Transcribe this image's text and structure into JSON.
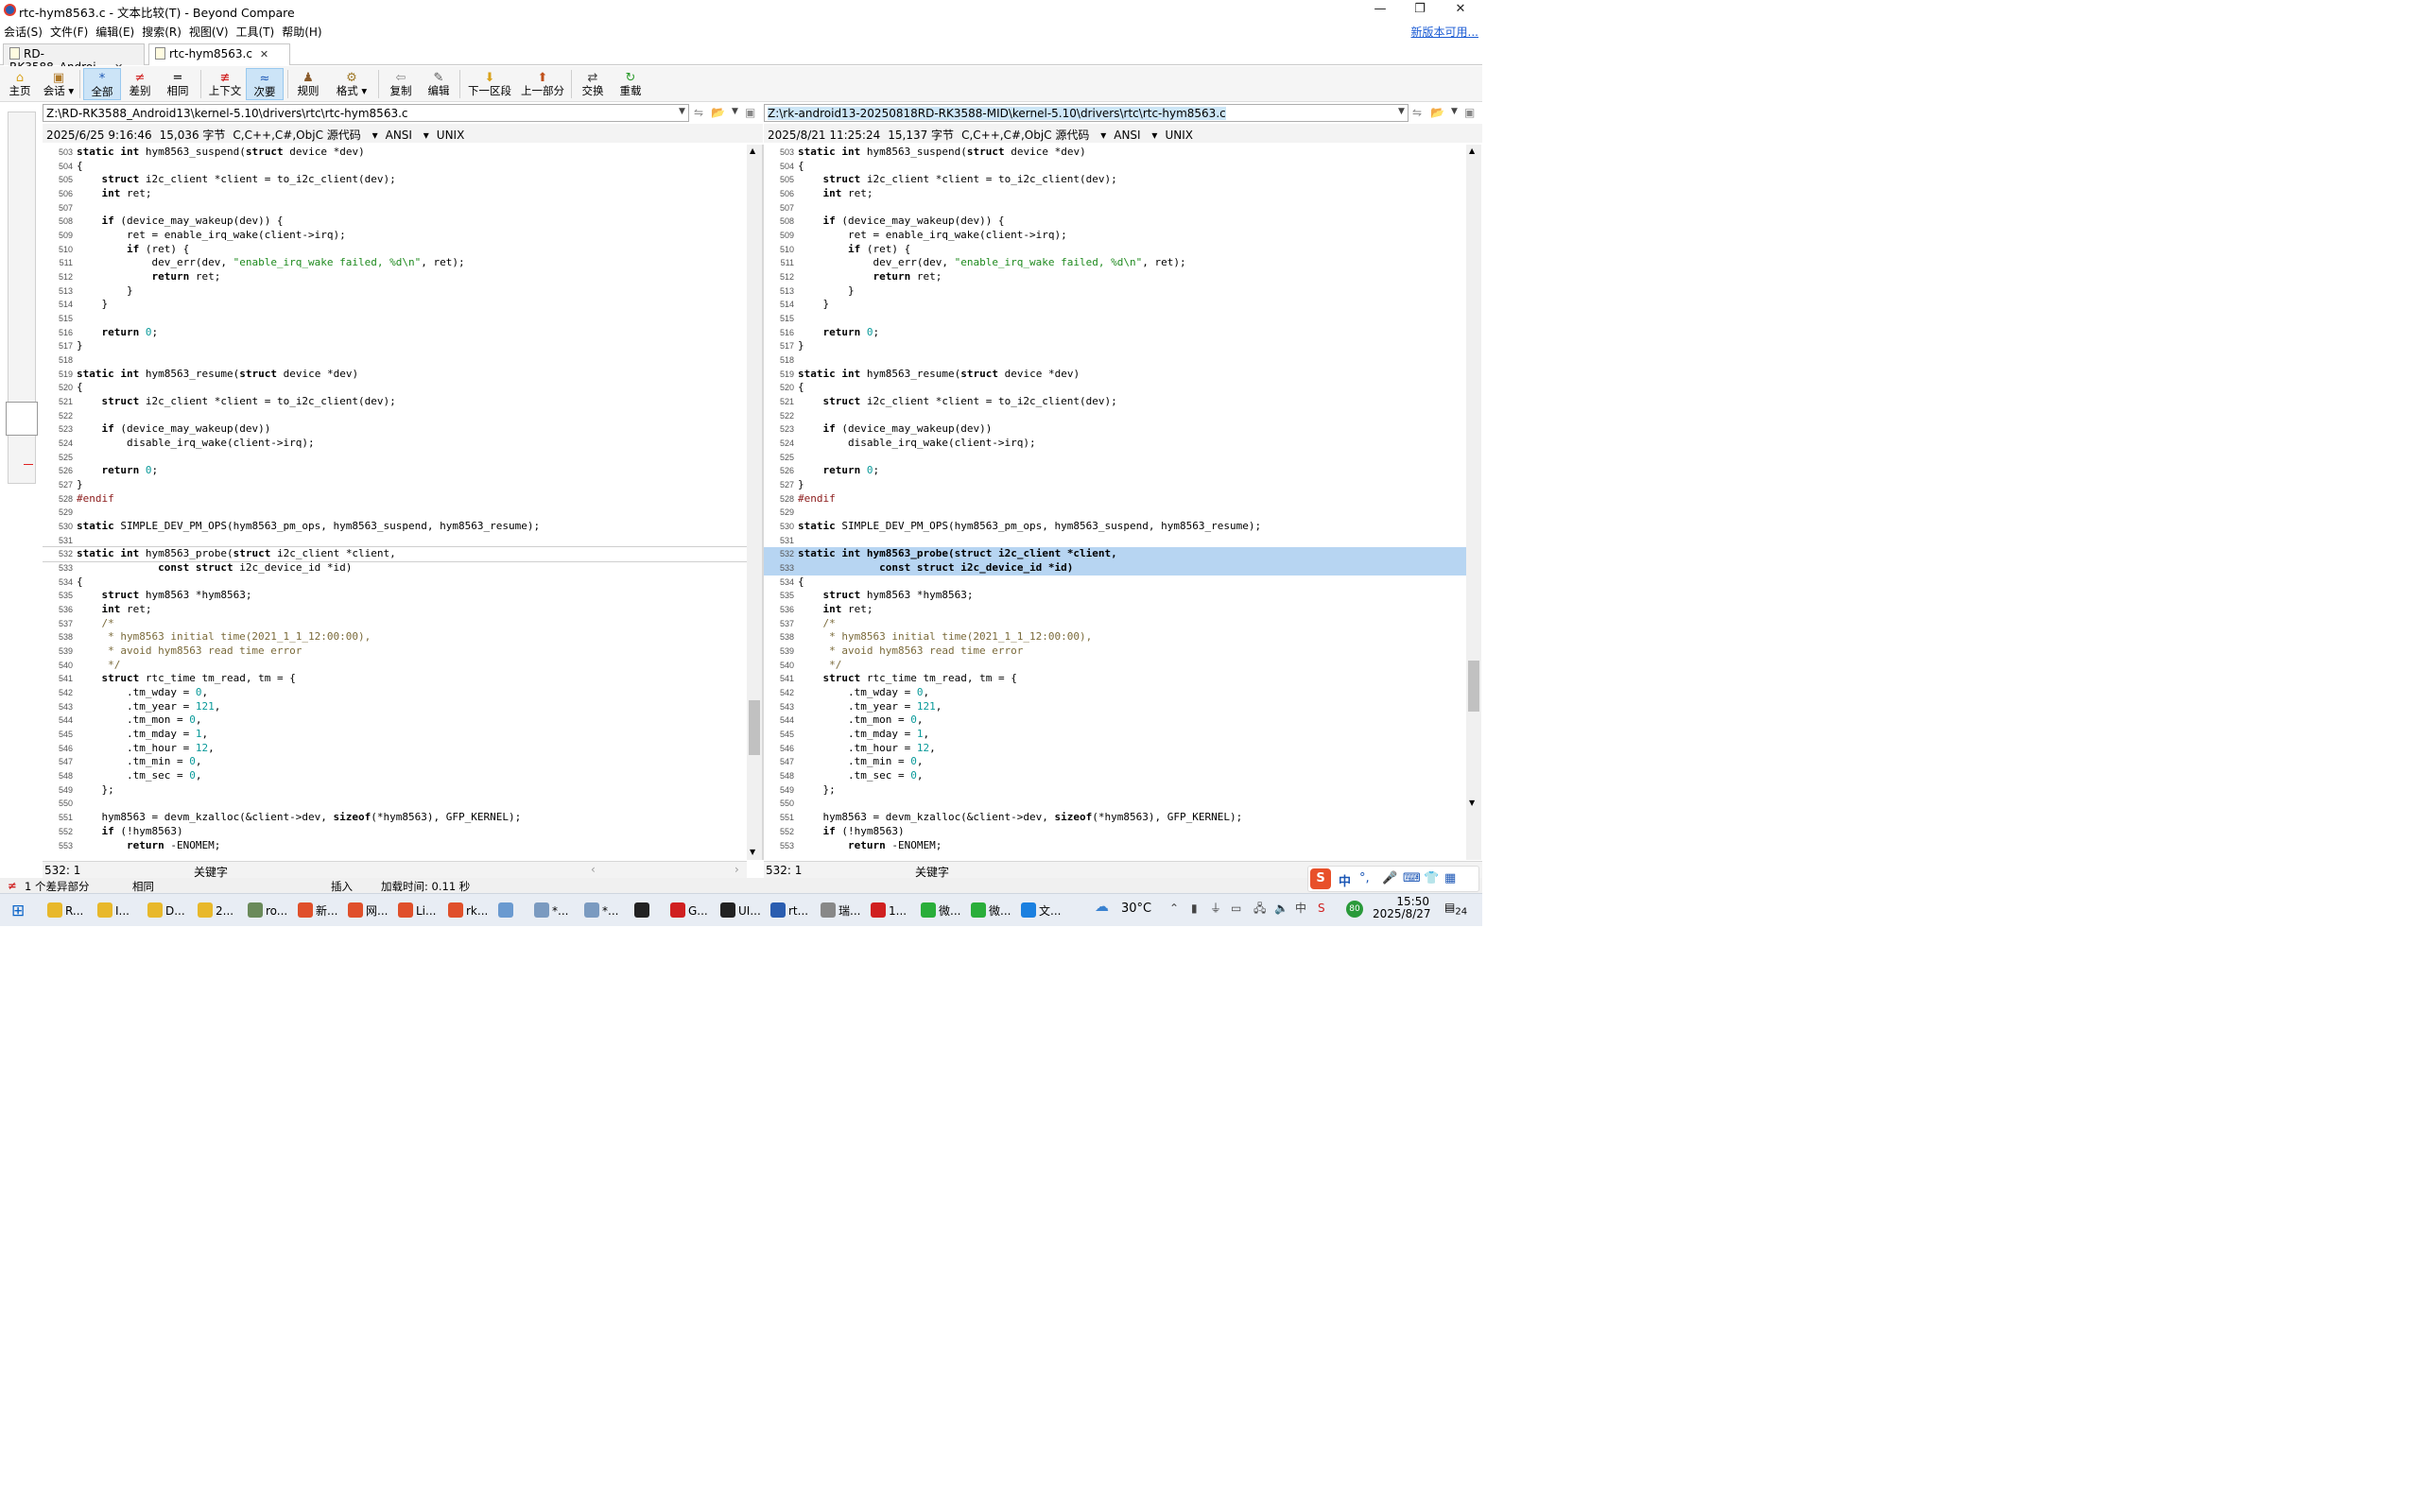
{
  "window": {
    "title": "rtc-hym8563.c - 文本比较(T) - Beyond Compare",
    "min": "—",
    "max": "❐",
    "close": "✕"
  },
  "menu": {
    "items": [
      "会话(S)",
      "文件(F)",
      "编辑(E)",
      "搜索(R)",
      "视图(V)",
      "工具(T)",
      "帮助(H)"
    ],
    "update": "新版本可用..."
  },
  "tabs": [
    {
      "label": "RD-RK3588_Androi...",
      "close": "✕"
    },
    {
      "label": "rtc-hym8563.c",
      "close": "✕"
    }
  ],
  "toolbar": {
    "items": [
      "主页",
      "会话",
      "全部",
      "差别",
      "相同",
      "上下文",
      "次要",
      "规则",
      "格式",
      "复制",
      "编辑",
      "下一区段",
      "上一部分",
      "交换",
      "重载"
    ]
  },
  "left": {
    "path": "Z:\\RD-RK3588_Android13\\kernel-5.10\\drivers\\rtc\\rtc-hym8563.c",
    "date": "2025/6/25 9:16:46",
    "size": "15,036 字节",
    "format": "C,C++,C#,ObjC 源代码",
    "encoding": "ANSI",
    "eol": "UNIX",
    "position": "532: 1",
    "status": "关键字"
  },
  "right": {
    "path": "Z:\\rk-android13-20250818RD-RK3588-MID\\kernel-5.10\\drivers\\rtc\\rtc-hym8563.c",
    "date": "2025/8/21 11:25:24",
    "size": "15,137 字节",
    "format": "C,C++,C#,ObjC 源代码",
    "encoding": "ANSI",
    "eol": "UNIX",
    "position": "532: 1",
    "status": "关键字"
  },
  "lines": [
    {
      "n": "503",
      "t": "static int hym8563_suspend(struct device *dev)"
    },
    {
      "n": "504",
      "t": "{"
    },
    {
      "n": "505",
      "t": "    struct i2c_client *client = to_i2c_client(dev);"
    },
    {
      "n": "506",
      "t": "    int ret;"
    },
    {
      "n": "507",
      "t": ""
    },
    {
      "n": "508",
      "t": "    if (device_may_wakeup(dev)) {"
    },
    {
      "n": "509",
      "t": "        ret = enable_irq_wake(client->irq);"
    },
    {
      "n": "510",
      "t": "        if (ret) {"
    },
    {
      "n": "511",
      "t": "            dev_err(dev, \"enable_irq_wake failed, %d\\n\", ret);"
    },
    {
      "n": "512",
      "t": "            return ret;"
    },
    {
      "n": "513",
      "t": "        }"
    },
    {
      "n": "514",
      "t": "    }"
    },
    {
      "n": "515",
      "t": ""
    },
    {
      "n": "516",
      "t": "    return 0;"
    },
    {
      "n": "517",
      "t": "}"
    },
    {
      "n": "518",
      "t": ""
    },
    {
      "n": "519",
      "t": "static int hym8563_resume(struct device *dev)"
    },
    {
      "n": "520",
      "t": "{"
    },
    {
      "n": "521",
      "t": "    struct i2c_client *client = to_i2c_client(dev);"
    },
    {
      "n": "522",
      "t": ""
    },
    {
      "n": "523",
      "t": "    if (device_may_wakeup(dev))"
    },
    {
      "n": "524",
      "t": "        disable_irq_wake(client->irq);"
    },
    {
      "n": "525",
      "t": ""
    },
    {
      "n": "526",
      "t": "    return 0;"
    },
    {
      "n": "527",
      "t": "}"
    },
    {
      "n": "528",
      "t": "#endif"
    },
    {
      "n": "529",
      "t": ""
    },
    {
      "n": "530",
      "t": "static SIMPLE_DEV_PM_OPS(hym8563_pm_ops, hym8563_suspend, hym8563_resume);"
    },
    {
      "n": "531",
      "t": ""
    },
    {
      "n": "532",
      "t": "static int hym8563_probe(struct i2c_client *client,"
    },
    {
      "n": "533",
      "t": "             const struct i2c_device_id *id)"
    },
    {
      "n": "534",
      "t": "{"
    },
    {
      "n": "535",
      "t": "    struct hym8563 *hym8563;"
    },
    {
      "n": "536",
      "t": "    int ret;"
    },
    {
      "n": "537",
      "t": "    /*"
    },
    {
      "n": "538",
      "t": "     * hym8563 initial time(2021_1_1_12:00:00),"
    },
    {
      "n": "539",
      "t": "     * avoid hym8563 read time error"
    },
    {
      "n": "540",
      "t": "     */"
    },
    {
      "n": "541",
      "t": "    struct rtc_time tm_read, tm = {"
    },
    {
      "n": "542",
      "t": "        .tm_wday = 0,"
    },
    {
      "n": "543",
      "t": "        .tm_year = 121,"
    },
    {
      "n": "544",
      "t": "        .tm_mon = 0,"
    },
    {
      "n": "545",
      "t": "        .tm_mday = 1,"
    },
    {
      "n": "546",
      "t": "        .tm_hour = 12,"
    },
    {
      "n": "547",
      "t": "        .tm_min = 0,"
    },
    {
      "n": "548",
      "t": "        .tm_sec = 0,"
    },
    {
      "n": "549",
      "t": "    };"
    },
    {
      "n": "550",
      "t": ""
    },
    {
      "n": "551",
      "t": "    hym8563 = devm_kzalloc(&client->dev, sizeof(*hym8563), GFP_KERNEL);"
    },
    {
      "n": "552",
      "t": "    if (!hym8563)"
    },
    {
      "n": "553",
      "t": "        return -ENOMEM;"
    }
  ],
  "bottom": {
    "diffs": "1 个差异部分",
    "same": "相同",
    "insert": "插入",
    "load": "加载时间: 0.11 秒"
  },
  "taskbar": {
    "items": [
      "R...",
      "I...",
      "D...",
      "2...",
      "ro...",
      "新...",
      "网...",
      "Li...",
      "rk...",
      "",
      "*...",
      "*...",
      "",
      "G...",
      "UI...",
      "rt...",
      "瑞...",
      "1...",
      "微...",
      "微...",
      "文..."
    ],
    "weather": "30°C",
    "time": "15:50",
    "date": "2025/8/27",
    "notif": "24",
    "battery": "80",
    "ime": "中"
  }
}
